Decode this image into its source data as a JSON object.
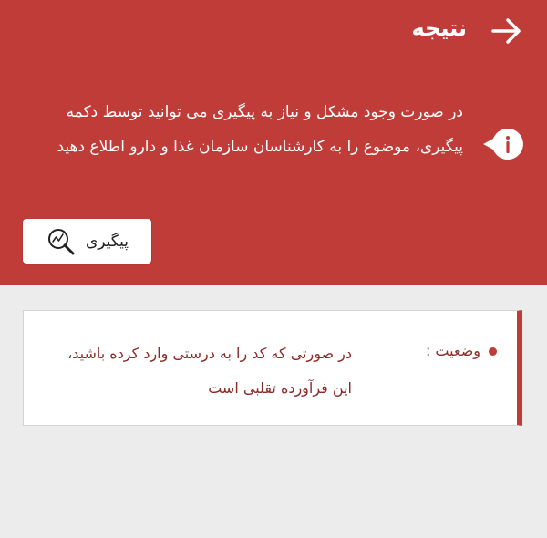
{
  "header": {
    "title": "نتیجه",
    "back_icon": "arrow-right-icon",
    "background_color": "#c03c38"
  },
  "info": {
    "icon": "info-icon",
    "message": "در صورت وجود مشکل و نیاز به پیگیری می توانید توسط دکمه پیگیری، موضوع را به کارشناسان سازمان غذا و دارو اطلاع دهید"
  },
  "track_button": {
    "label": "پیگیری",
    "icon": "search-trend-icon"
  },
  "result": {
    "status_label": "وضعیت :",
    "status_text": "در صورتی که کد را به درستی وارد کرده باشید، این فرآورده تقلبی است",
    "accent_color": "#c03c38",
    "text_color": "#8a2b27"
  }
}
